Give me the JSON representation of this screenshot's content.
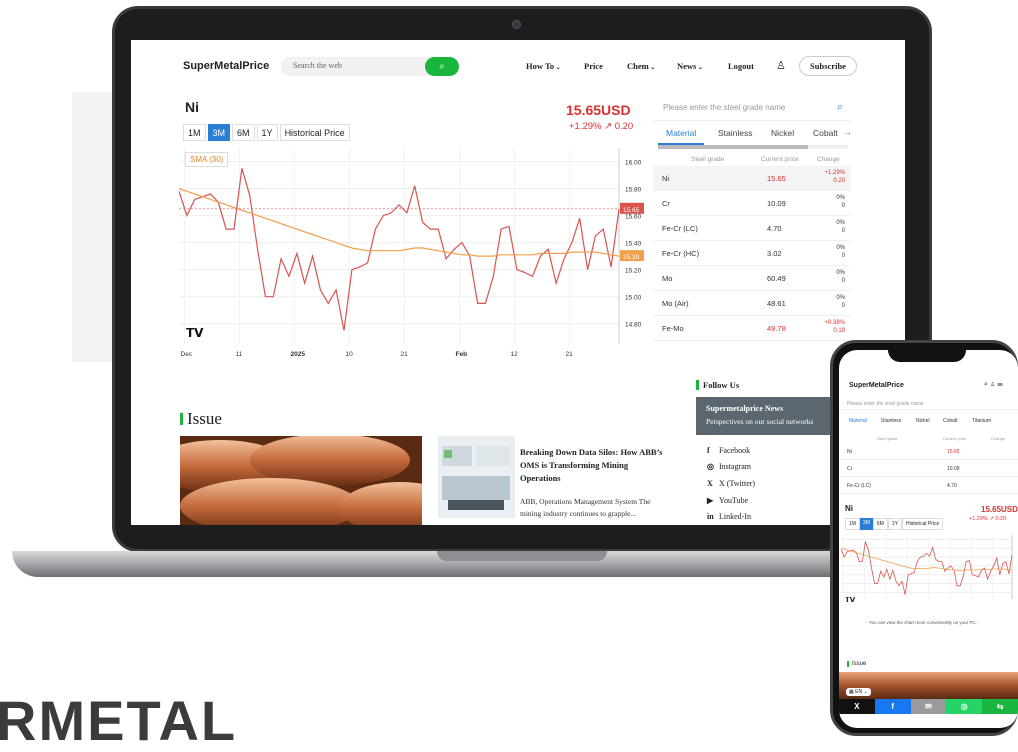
{
  "brand_watermark": "RMETAL",
  "site": {
    "logo": "SuperMetalPrice",
    "search_placeholder": "Search the web",
    "nav": [
      "How To",
      "Price",
      "Chem",
      "News",
      "Logout"
    ],
    "subscribe": "Subscribe"
  },
  "metal": {
    "name": "Ni",
    "price": "15.65USD",
    "change": "+1.29%  ↗ 0.20",
    "ranges": [
      "1M",
      "3M",
      "6M",
      "1Y",
      "Historical Price"
    ],
    "active_range": "3M",
    "sma_label": "SMA (30)",
    "tv_logo": "TV"
  },
  "chart_data": {
    "type": "line",
    "title": "",
    "x_ticks": [
      "Dec",
      "11",
      "2025",
      "10",
      "21",
      "Feb",
      "12",
      "21"
    ],
    "y_ticks": [
      16.0,
      15.8,
      15.6,
      15.4,
      15.2,
      15.0,
      14.8
    ],
    "ylim": [
      14.65,
      16.1
    ],
    "last_price_label": "15.65",
    "sma_label_value": "15.30",
    "series": [
      {
        "name": "Ni",
        "color": "#d9534f",
        "values": [
          15.78,
          15.6,
          15.72,
          15.74,
          15.76,
          15.7,
          15.5,
          15.5,
          15.95,
          15.75,
          15.35,
          15.0,
          15.0,
          15.28,
          15.15,
          15.32,
          15.1,
          15.3,
          15.05,
          14.95,
          15.05,
          14.75,
          15.2,
          15.22,
          15.25,
          15.5,
          15.6,
          15.62,
          15.68,
          15.62,
          15.82,
          15.55,
          15.5,
          15.5,
          15.28,
          15.35,
          15.4,
          15.3,
          14.95,
          14.95,
          15.15,
          15.5,
          15.52,
          15.2,
          15.18,
          15.15,
          15.3,
          15.35,
          15.1,
          15.28,
          15.4,
          15.58,
          15.2,
          15.45,
          15.5,
          15.22,
          15.65
        ]
      },
      {
        "name": "SMA (30)",
        "color": "#f0a04b",
        "values": [
          15.8,
          15.78,
          15.76,
          15.74,
          15.72,
          15.7,
          15.68,
          15.66,
          15.64,
          15.62,
          15.6,
          15.58,
          15.56,
          15.54,
          15.52,
          15.5,
          15.48,
          15.46,
          15.44,
          15.42,
          15.4,
          15.38,
          15.36,
          15.35,
          15.34,
          15.34,
          15.34,
          15.34,
          15.34,
          15.35,
          15.36,
          15.36,
          15.35,
          15.34,
          15.33,
          15.32,
          15.31,
          15.31,
          15.3,
          15.3,
          15.3,
          15.31,
          15.31,
          15.31,
          15.31,
          15.31,
          15.32,
          15.32,
          15.32,
          15.32,
          15.33,
          15.33,
          15.33,
          15.33,
          15.32,
          15.31,
          15.3
        ]
      }
    ],
    "grid": true
  },
  "table": {
    "search_placeholder": "Please enter the steel grade name",
    "categories": [
      "Material",
      "Stainless",
      "Nickel",
      "Cobalt"
    ],
    "active_category": "Material",
    "headers": [
      "Steel grade",
      "Current price",
      "Change"
    ],
    "rows": [
      {
        "name": "Ni",
        "price": "15.65",
        "chg1": "+1.29%",
        "chg2": "0.20",
        "up": true
      },
      {
        "name": "Cr",
        "price": "10.09",
        "chg1": "0%",
        "chg2": "0",
        "up": false
      },
      {
        "name": "Fe-Cr (LC)",
        "price": "4.70",
        "chg1": "0%",
        "chg2": "0",
        "up": false
      },
      {
        "name": "Fe-Cr (HC)",
        "price": "3.02",
        "chg1": "0%",
        "chg2": "0",
        "up": false
      },
      {
        "name": "Mo",
        "price": "60.49",
        "chg1": "0%",
        "chg2": "0",
        "up": false
      },
      {
        "name": "Mo (Air)",
        "price": "48.61",
        "chg1": "0%",
        "chg2": "0",
        "up": false
      },
      {
        "name": "Fe-Mo",
        "price": "49.78",
        "chg1": "+0.38%",
        "chg2": "0.19",
        "up": true
      }
    ]
  },
  "issue": {
    "title": "Issue",
    "news_title": "Breaking Down Data Silos: How ABB’s OMS is Transforming Mining Operations",
    "news_body": "ABB, Operations Management System The mining industry continues to grapple..."
  },
  "follow": {
    "label": "Follow Us",
    "box_title": "Supermetalprice News",
    "box_sub": "Perspectives on our social networks",
    "networks": [
      "Facebook",
      "Instagram",
      "X (Twitter)",
      "YouTube",
      "Linked-In"
    ]
  },
  "phone": {
    "logo": "SuperMetalPrice",
    "search_placeholder": "Please enter the steel grade name",
    "categories": [
      "Material",
      "Stainless",
      "Nickel",
      "Cobalt",
      "Titanium"
    ],
    "headers": [
      "Steel grade",
      "Current price",
      "Change"
    ],
    "rows": [
      {
        "name": "Ni",
        "price": "15.65",
        "up": true
      },
      {
        "name": "Cr",
        "price": "10.09",
        "up": false
      },
      {
        "name": "Fe-Cr (LC)",
        "price": "4.70",
        "up": false
      }
    ],
    "metal_name": "Ni",
    "price": "15.65USD",
    "change": "+1.29%  ↗ 0.20",
    "ranges": [
      "1M",
      "3M",
      "6M",
      "1Y",
      "Historical Price"
    ],
    "note": "You can view the chart more conveniently on your PC.",
    "issue": "Issue",
    "lang": "EN",
    "share": [
      "X",
      "f",
      "✉",
      "◎",
      "⇆"
    ]
  }
}
